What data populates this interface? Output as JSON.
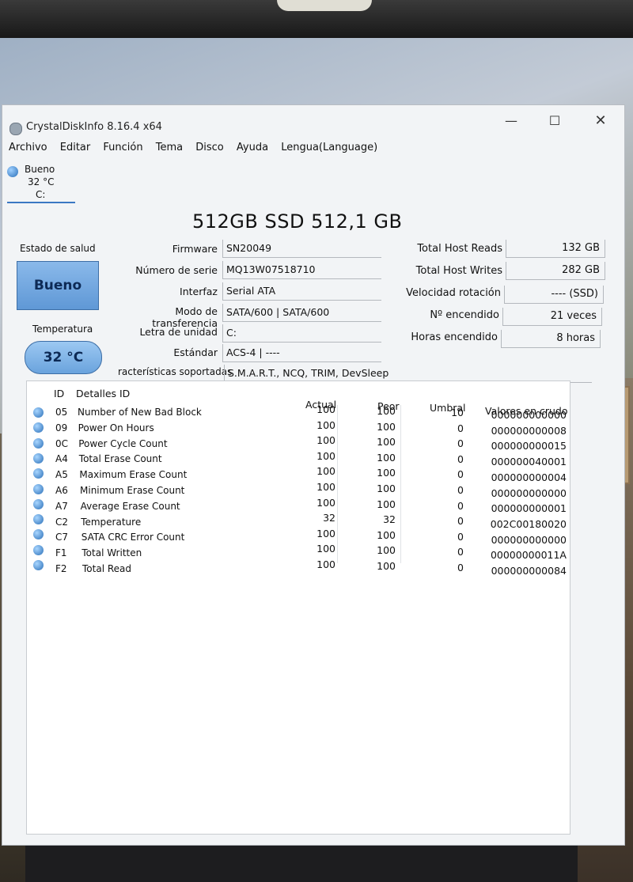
{
  "window": {
    "title": "CrystalDiskInfo 8.16.4 x64",
    "controls": {
      "minimize": "—",
      "maximize": "☐",
      "close": "✕"
    }
  },
  "menu": [
    "Archivo",
    "Editar",
    "Función",
    "Tema",
    "Disco",
    "Ayuda",
    "Lengua(Language)"
  ],
  "drive_tab": {
    "status": "Bueno",
    "temp": "32 °C",
    "letter": "C:"
  },
  "disk_title": "512GB SSD 512,1 GB",
  "health": {
    "label": "Estado de salud",
    "value": "Bueno"
  },
  "temperature": {
    "label": "Temperatura",
    "value": "32 °C"
  },
  "info": [
    {
      "label": "Firmware",
      "value": "SN20049"
    },
    {
      "label": "Número de serie",
      "value": "MQ13W07518710"
    },
    {
      "label": "Interfaz",
      "value": "Serial ATA"
    },
    {
      "label": "Modo de transferencia",
      "value": "SATA/600 | SATA/600"
    },
    {
      "label": "Letra de unidad",
      "value": "C:"
    },
    {
      "label": "Estándar",
      "value": "ACS-4 | ----"
    }
  ],
  "features": {
    "label": "racterísticas soportadas",
    "value": "S.M.A.R.T., NCQ, TRIM, DevSleep"
  },
  "right_info": [
    {
      "label": "Total Host Reads",
      "value": "132 GB"
    },
    {
      "label": "Total Host Writes",
      "value": "282 GB"
    },
    {
      "label": "Velocidad rotación",
      "value": "---- (SSD)"
    },
    {
      "label": "Nº encendido",
      "value": "21 veces"
    },
    {
      "label": "Horas encendido",
      "value": "8 horas"
    }
  ],
  "table": {
    "headers": {
      "id": "ID",
      "name": "Detalles ID",
      "current": "Actual",
      "worst": "Peor",
      "threshold": "Umbral",
      "raw": "Valores en crudo"
    },
    "rows": [
      {
        "id": "05",
        "name": "Number of New Bad Block",
        "current": "100",
        "worst": "100",
        "threshold": "10",
        "raw": "000000000000"
      },
      {
        "id": "09",
        "name": "Power On Hours",
        "current": "100",
        "worst": "100",
        "threshold": "0",
        "raw": "000000000008"
      },
      {
        "id": "0C",
        "name": "Power Cycle Count",
        "current": "100",
        "worst": "100",
        "threshold": "0",
        "raw": "000000000015"
      },
      {
        "id": "A4",
        "name": "Total Erase Count",
        "current": "100",
        "worst": "100",
        "threshold": "0",
        "raw": "000000040001"
      },
      {
        "id": "A5",
        "name": "Maximum Erase Count",
        "current": "100",
        "worst": "100",
        "threshold": "0",
        "raw": "000000000004"
      },
      {
        "id": "A6",
        "name": "Minimum Erase Count",
        "current": "100",
        "worst": "100",
        "threshold": "0",
        "raw": "000000000000"
      },
      {
        "id": "A7",
        "name": "Average Erase Count",
        "current": "100",
        "worst": "100",
        "threshold": "0",
        "raw": "000000000001"
      },
      {
        "id": "C2",
        "name": "Temperature",
        "current": "32",
        "worst": "32",
        "threshold": "0",
        "raw": "002C00180020"
      },
      {
        "id": "C7",
        "name": "SATA CRC Error Count",
        "current": "100",
        "worst": "100",
        "threshold": "0",
        "raw": "000000000000"
      },
      {
        "id": "F1",
        "name": "Total Written",
        "current": "100",
        "worst": "100",
        "threshold": "0",
        "raw": "00000000011A"
      },
      {
        "id": "F2",
        "name": "Total Read",
        "current": "100",
        "worst": "100",
        "threshold": "0",
        "raw": "000000000084"
      }
    ]
  },
  "colors": {
    "accent": "#3b78c3",
    "health_good": "#6fa8e0",
    "text": "#111111"
  }
}
